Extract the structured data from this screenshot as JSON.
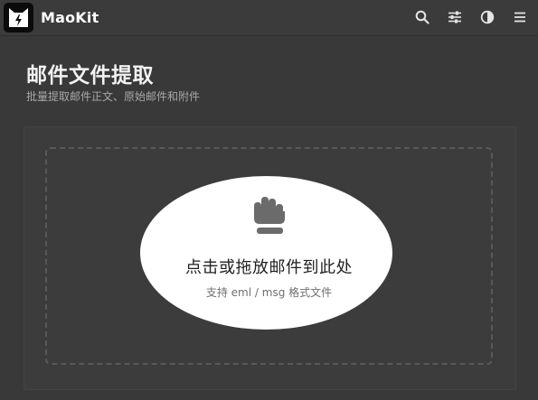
{
  "header": {
    "app_name": "MaoKit",
    "icons": [
      "search-icon",
      "sliders-icon",
      "contrast-icon",
      "menu-icon"
    ]
  },
  "page": {
    "title": "邮件文件提取",
    "subtitle": "批量提取邮件正文、原始邮件和附件"
  },
  "upload": {
    "title": "点击或拖放邮件到此处",
    "hint": "支持 eml / msg 格式文件"
  },
  "colors": {
    "background": "#393939",
    "header": "#3b3b3b",
    "dropzone_highlight": "#ffffff",
    "icon": "#6b6b6b"
  }
}
